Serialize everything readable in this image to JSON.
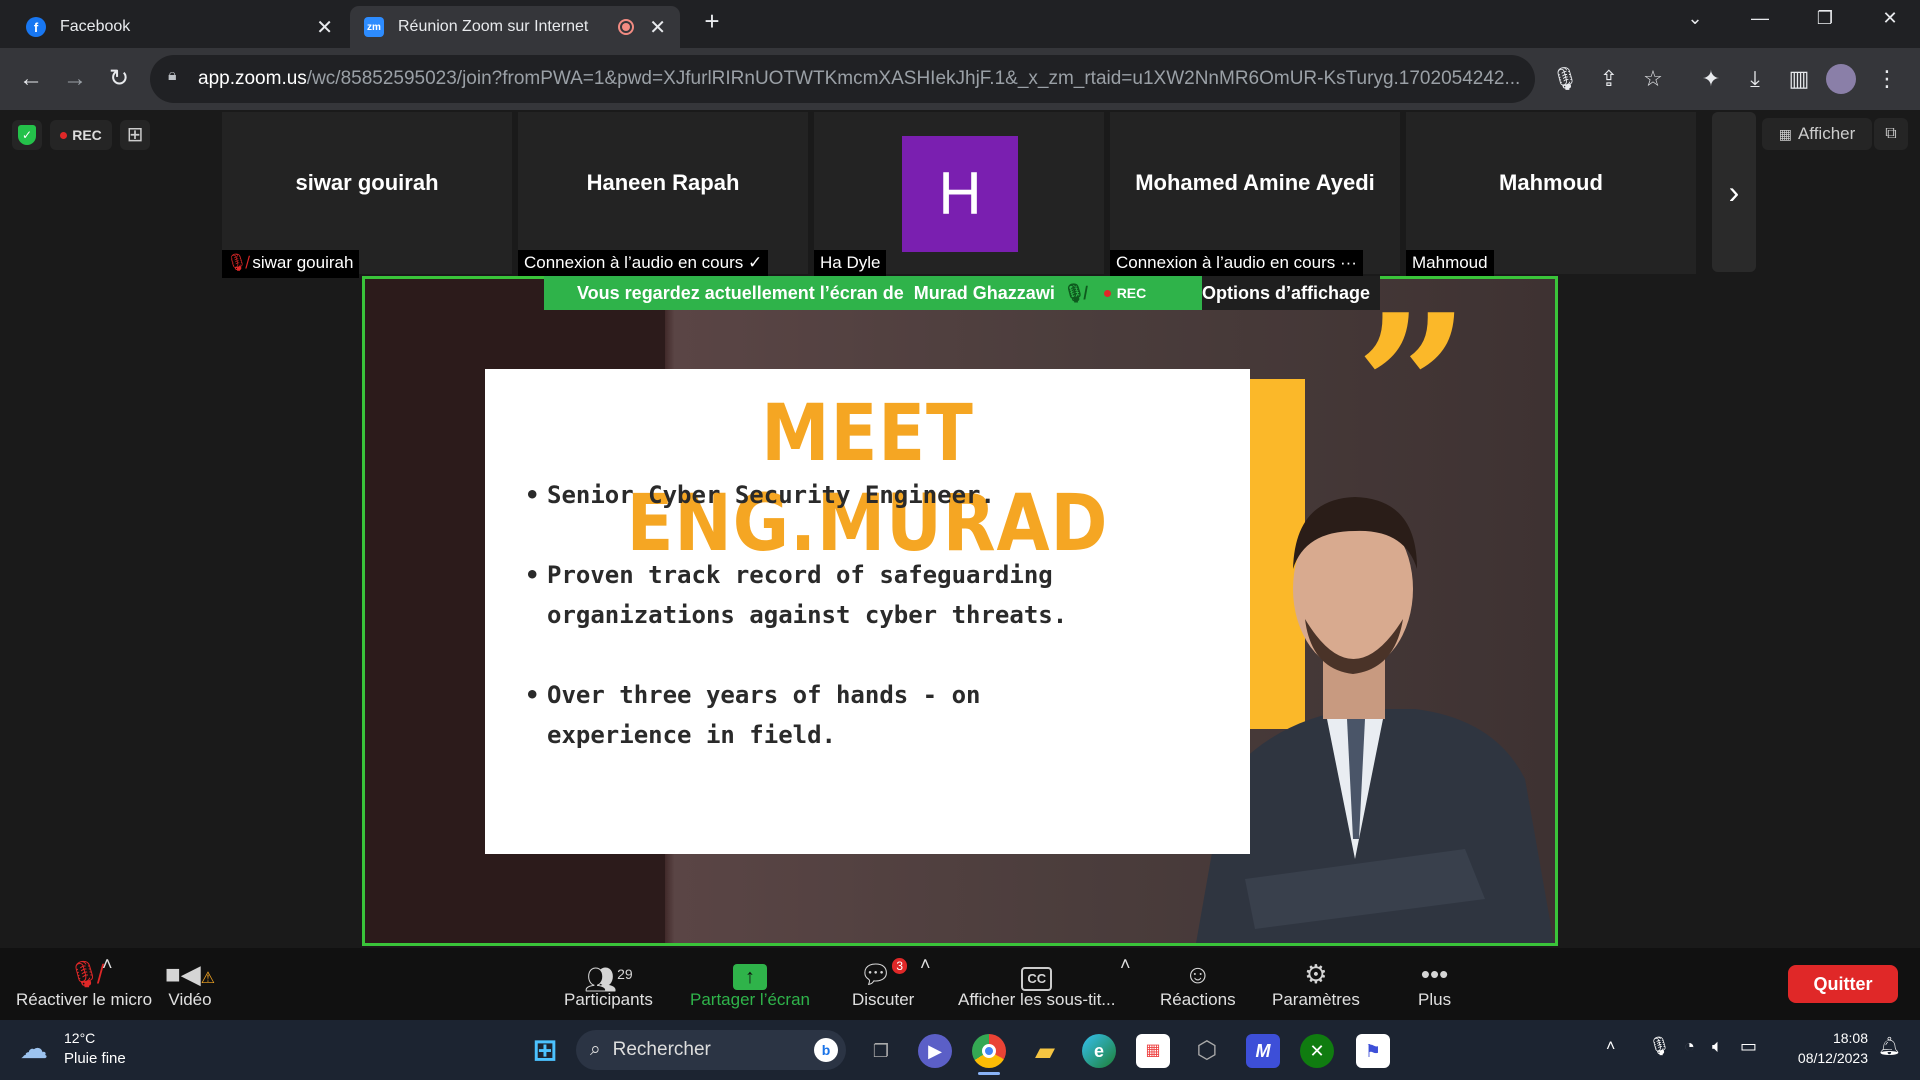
{
  "browser": {
    "tabs": [
      {
        "title": "Facebook",
        "favicon": "facebook-icon"
      },
      {
        "title": "Réunion Zoom sur Internet",
        "favicon": "zoom-icon",
        "recording": true
      }
    ],
    "url_host": "app.zoom.us",
    "url_path": "/wc/85852595023/join?fromPWA=1&pwd=XJfurlRIRnUOTWTKmcmXASHIekJhjF.1&_x_zm_rtaid=u1XW2NnMR6OmUR-KsTuryg.1702054242..."
  },
  "zoom_top": {
    "rec": "REC",
    "view": "Afficher"
  },
  "participants_strip": [
    {
      "name": "siwar gouirah",
      "label": "siwar gouirah",
      "muted": true
    },
    {
      "name": "Haneen Rapah",
      "label": "Connexion à l’audio en cours ✓"
    },
    {
      "name": "",
      "avatar_letter": "H",
      "label": "Ha Dyle"
    },
    {
      "name": "Mohamed Amine Ayedi",
      "label": "Connexion à l’audio en cours ···"
    },
    {
      "name": "Mahmoud",
      "label": "Mahmoud"
    }
  ],
  "share_banner": {
    "text": "Vous regardez actuellement l’écran de",
    "presenter": "Murad Ghazzawi",
    "rec": "REC",
    "options": "Options d’affichage"
  },
  "slide": {
    "title": "MEET ENG.MURAD",
    "bullets": [
      [
        "Senior Cyber Security Engineer."
      ],
      [
        "Proven track record of safeguarding",
        "organizations against cyber threats."
      ],
      [
        "Over three years of hands - on",
        "experience in field."
      ]
    ]
  },
  "controls": {
    "mic": "Réactiver le micro",
    "video": "Vidéo",
    "participants": "Participants",
    "participants_count": "29",
    "share": "Partager l’écran",
    "chat": "Discuter",
    "chat_badge": "3",
    "captions": "Afficher les sous-tit...",
    "reactions": "Réactions",
    "settings": "Paramètres",
    "more": "Plus",
    "quit": "Quitter"
  },
  "taskbar": {
    "weather_temp": "12°C",
    "weather_desc": "Pluie fine",
    "search": "Rechercher",
    "time": "18:08",
    "date": "08/12/2023"
  },
  "colors": {
    "accent_green": "#2fb34a",
    "slide_orange": "#f5a623",
    "quit_red": "#e02828"
  }
}
